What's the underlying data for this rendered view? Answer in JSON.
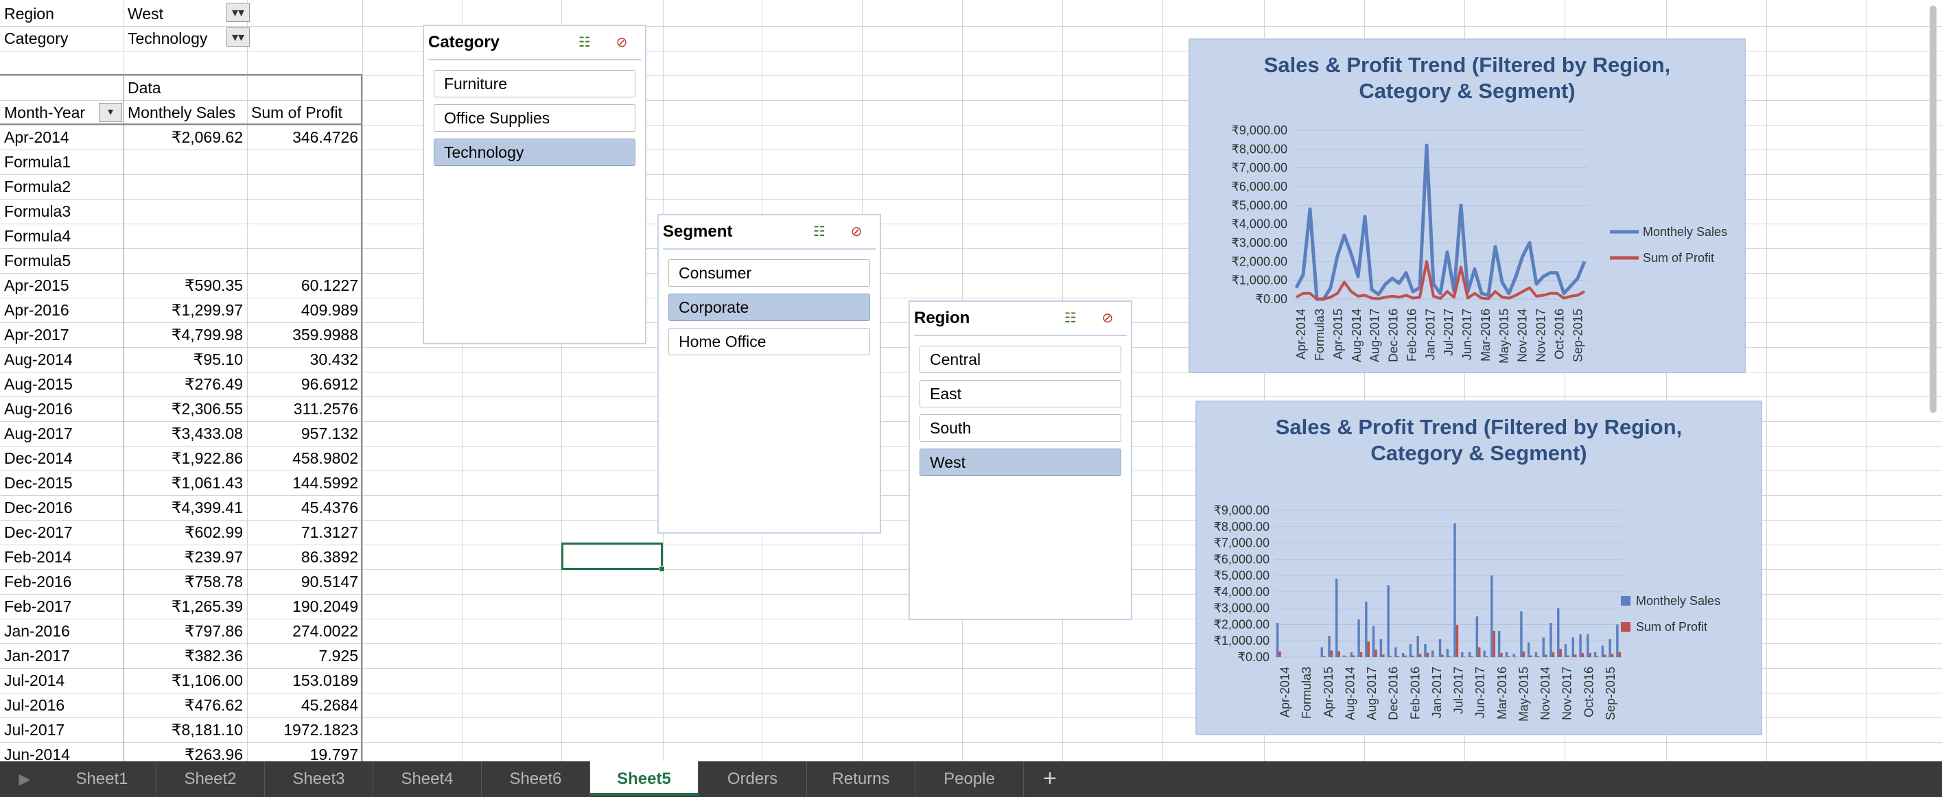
{
  "filters": [
    {
      "label": "Region",
      "value": "West"
    },
    {
      "label": "Category",
      "value": "Technology"
    }
  ],
  "pivot": {
    "data_header": "Data",
    "col_headers": [
      "Month-Year",
      "Monthely Sales",
      "Sum of Profit"
    ],
    "rows": [
      [
        "Apr-2014",
        "₹2,069.62",
        "346.4726"
      ],
      [
        "Formula1",
        "",
        ""
      ],
      [
        "Formula2",
        "",
        ""
      ],
      [
        "Formula3",
        "",
        ""
      ],
      [
        "Formula4",
        "",
        ""
      ],
      [
        "Formula5",
        "",
        ""
      ],
      [
        "Apr-2015",
        "₹590.35",
        "60.1227"
      ],
      [
        "Apr-2016",
        "₹1,299.97",
        "409.989"
      ],
      [
        "Apr-2017",
        "₹4,799.98",
        "359.9988"
      ],
      [
        "Aug-2014",
        "₹95.10",
        "30.432"
      ],
      [
        "Aug-2015",
        "₹276.49",
        "96.6912"
      ],
      [
        "Aug-2016",
        "₹2,306.55",
        "311.2576"
      ],
      [
        "Aug-2017",
        "₹3,433.08",
        "957.132"
      ],
      [
        "Dec-2014",
        "₹1,922.86",
        "458.9802"
      ],
      [
        "Dec-2015",
        "₹1,061.43",
        "144.5992"
      ],
      [
        "Dec-2016",
        "₹4,399.41",
        "45.4376"
      ],
      [
        "Dec-2017",
        "₹602.99",
        "71.3127"
      ],
      [
        "Feb-2014",
        "₹239.97",
        "86.3892"
      ],
      [
        "Feb-2016",
        "₹758.78",
        "90.5147"
      ],
      [
        "Feb-2017",
        "₹1,265.39",
        "190.2049"
      ],
      [
        "Jan-2016",
        "₹797.86",
        "274.0022"
      ],
      [
        "Jan-2017",
        "₹382.36",
        "7.925"
      ],
      [
        "Jul-2014",
        "₹1,106.00",
        "153.0189"
      ],
      [
        "Jul-2016",
        "₹476.62",
        "45.2684"
      ],
      [
        "Jul-2017",
        "₹8,181.10",
        "1972.1823"
      ],
      [
        "Jun-2014",
        "₹263.96",
        "19.797"
      ]
    ]
  },
  "slicers": {
    "category": {
      "title": "Category",
      "items": [
        "Furniture",
        "Office Supplies",
        "Technology"
      ],
      "selected": "Technology"
    },
    "segment": {
      "title": "Segment",
      "items": [
        "Consumer",
        "Corporate",
        "Home Office"
      ],
      "selected": "Corporate"
    },
    "region": {
      "title": "Region",
      "items": [
        "Central",
        "East",
        "South",
        "West"
      ],
      "selected": "West"
    }
  },
  "slicer_icons": {
    "multi_select": "multi-select-icon",
    "clear_filter": "clear-filter-icon"
  },
  "chart_data": [
    {
      "type": "line",
      "title": "Sales & Profit Trend (Filtered by Region, Category & Segment)",
      "ytick_labels": [
        "₹0.00",
        "₹1,000.00",
        "₹2,000.00",
        "₹3,000.00",
        "₹4,000.00",
        "₹5,000.00",
        "₹6,000.00",
        "₹7,000.00",
        "₹8,000.00",
        "₹9,000.00"
      ],
      "ylim": [
        0,
        9000
      ],
      "xtick_labels": [
        "Apr-2014",
        "Formula3",
        "Apr-2015",
        "Aug-2014",
        "Aug-2017",
        "Dec-2016",
        "Feb-2016",
        "Jan-2017",
        "Jul-2017",
        "Jun-2017",
        "Mar-2016",
        "May-2015",
        "Nov-2014",
        "Nov-2017",
        "Oct-2016",
        "Sep-2015"
      ],
      "legend": "right",
      "series": [
        {
          "name": "Monthely Sales",
          "color": "#5b7fbf",
          "values": [
            600,
            1300,
            4800,
            0,
            0,
            600,
            2300,
            3400,
            2400,
            1200,
            4400,
            500,
            250,
            800,
            1100,
            850,
            1400,
            400,
            600,
            8200,
            800,
            300,
            2500,
            400,
            5000,
            400,
            1600,
            300,
            200,
            2800,
            900,
            300,
            1200,
            2300,
            3000,
            800,
            1200,
            1400,
            1400,
            300,
            700,
            1100,
            2000
          ]
        },
        {
          "name": "Sum of Profit",
          "color": "#c0504d",
          "values": [
            100,
            300,
            300,
            0,
            0,
            100,
            300,
            900,
            400,
            150,
            200,
            50,
            20,
            100,
            150,
            100,
            200,
            50,
            100,
            2000,
            150,
            30,
            400,
            100,
            1700,
            50,
            300,
            50,
            20,
            400,
            100,
            50,
            200,
            400,
            600,
            150,
            200,
            300,
            300,
            50,
            150,
            200,
            400
          ]
        }
      ]
    },
    {
      "type": "bar",
      "title": "Sales & Profit Trend (Filtered by Region, Category & Segment)",
      "ytick_labels": [
        "₹0.00",
        "₹1,000.00",
        "₹2,000.00",
        "₹3,000.00",
        "₹4,000.00",
        "₹5,000.00",
        "₹6,000.00",
        "₹7,000.00",
        "₹8,000.00",
        "₹9,000.00"
      ],
      "ylim": [
        0,
        9000
      ],
      "xtick_labels": [
        "Apr-2014",
        "Formula3",
        "Apr-2015",
        "Aug-2014",
        "Aug-2017",
        "Dec-2016",
        "Feb-2016",
        "Jan-2017",
        "Jul-2017",
        "Jun-2017",
        "Mar-2016",
        "May-2015",
        "Nov-2014",
        "Nov-2017",
        "Oct-2016",
        "Sep-2015"
      ],
      "legend": "right",
      "series": [
        {
          "name": "Monthely Sales",
          "color": "#5b7fbf",
          "values": [
            2100,
            0,
            0,
            0,
            0,
            0,
            600,
            1300,
            4800,
            100,
            300,
            2300,
            3400,
            1900,
            1100,
            4400,
            600,
            250,
            800,
            1300,
            800,
            400,
            1100,
            500,
            8200,
            300,
            300,
            2500,
            400,
            5000,
            1600,
            300,
            200,
            2800,
            900,
            300,
            1200,
            2100,
            3000,
            800,
            1200,
            1400,
            1400,
            300,
            700,
            1100,
            2000
          ]
        },
        {
          "name": "Sum of Profit",
          "color": "#c0504d",
          "values": [
            350,
            0,
            0,
            0,
            0,
            0,
            60,
            400,
            360,
            30,
            100,
            300,
            950,
            450,
            150,
            50,
            70,
            90,
            90,
            190,
            270,
            10,
            150,
            50,
            1970,
            20,
            50,
            600,
            50,
            1600,
            250,
            50,
            20,
            350,
            100,
            50,
            150,
            300,
            500,
            100,
            150,
            250,
            250,
            50,
            150,
            200,
            300
          ]
        }
      ]
    }
  ],
  "tabs": [
    "Sheet1",
    "Sheet2",
    "Sheet3",
    "Sheet4",
    "Sheet6",
    "Sheet5",
    "Orders",
    "Returns",
    "People"
  ],
  "active_tab": "Sheet5",
  "tab_add_label": "+",
  "tab_nav_label": "▶"
}
